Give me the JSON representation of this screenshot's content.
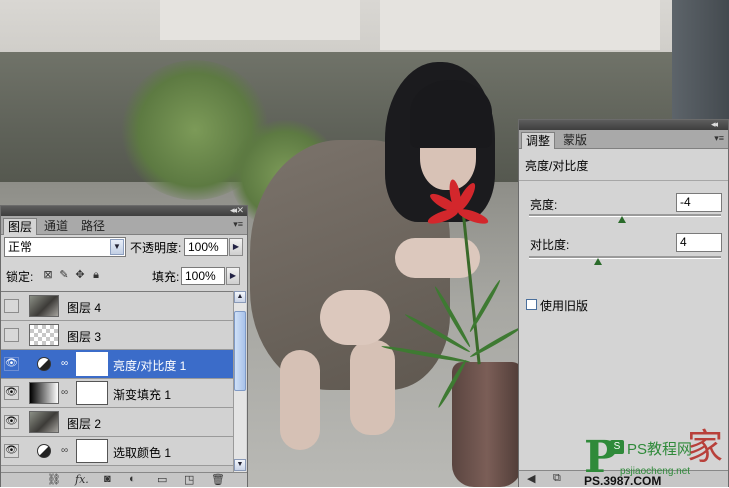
{
  "layers_panel": {
    "tabs": [
      "图层",
      "通道",
      "路径"
    ],
    "blend_mode": "正常",
    "opacity_label": "不透明度:",
    "opacity_value": "100%",
    "lock_label": "锁定:",
    "fill_label": "填充:",
    "fill_value": "100%",
    "layers": [
      {
        "name": "图层 4",
        "visible": false,
        "selected": false
      },
      {
        "name": "图层 3",
        "visible": false,
        "selected": false
      },
      {
        "name": "亮度/对比度 1",
        "visible": true,
        "selected": true
      },
      {
        "name": "渐变填充 1",
        "visible": true,
        "selected": false
      },
      {
        "name": "图层 2",
        "visible": true,
        "selected": false
      },
      {
        "name": "选取颜色 1",
        "visible": true,
        "selected": false
      }
    ],
    "bottom_icons": [
      "link-icon",
      "fx-icon",
      "mask-icon",
      "adjustment-icon",
      "group-icon",
      "new-layer-icon",
      "trash-icon"
    ],
    "fx_label": "fx."
  },
  "adjust_panel": {
    "tabs": [
      "调整",
      "蒙版"
    ],
    "title": "亮度/对比度",
    "brightness_label": "亮度:",
    "brightness_value": "-4",
    "brightness_level": -4,
    "contrast_label": "对比度:",
    "contrast_value": "4",
    "contrast_level": 4,
    "legacy_label": "使用旧版",
    "legacy_checked": false
  },
  "watermark": {
    "ps_letters": "P",
    "s_box": "S",
    "cn_text": "PS教程网",
    "big_char": "家",
    "url": "psjiaocheng.net",
    "site2": "PS.3987.COM"
  },
  "colors": {
    "panel_bg": "#d4d4d4",
    "selection": "#3b6cc9",
    "watermark_green": "#2f8a3a"
  }
}
